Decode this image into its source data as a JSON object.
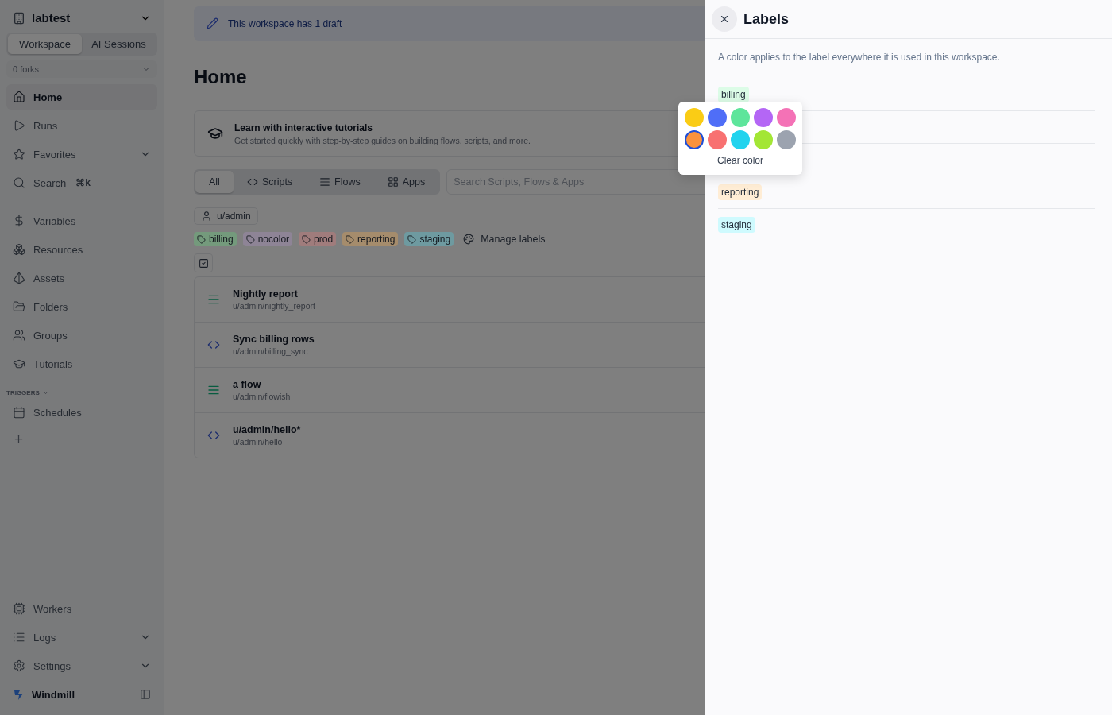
{
  "sidebar": {
    "workspace": "labtest",
    "mode_tabs": [
      {
        "label": "Workspace",
        "selected": true
      },
      {
        "label": "AI Sessions",
        "selected": false
      }
    ],
    "forks": "0 forks",
    "items": [
      {
        "label": "Home",
        "selected": true,
        "chevron": false
      },
      {
        "label": "Runs",
        "selected": false,
        "chevron": false
      },
      {
        "label": "Favorites",
        "selected": false,
        "chevron": true
      },
      {
        "label": "Search",
        "shortcut": "⌘k",
        "selected": false,
        "chevron": false
      },
      {
        "label": "Variables",
        "selected": false,
        "chevron": false
      },
      {
        "label": "Resources",
        "selected": false,
        "chevron": false
      },
      {
        "label": "Assets",
        "selected": false,
        "chevron": false
      },
      {
        "label": "Folders",
        "selected": false,
        "chevron": false
      },
      {
        "label": "Groups",
        "selected": false,
        "chevron": false
      },
      {
        "label": "Tutorials",
        "selected": false,
        "chevron": false
      }
    ],
    "section": "TRIGGERS",
    "trigger_items": [
      {
        "label": "Schedules",
        "selected": false,
        "chevron": false
      }
    ],
    "bottom_items": [
      {
        "label": "Workers",
        "selected": false,
        "chevron": false
      },
      {
        "label": "Logs",
        "selected": false,
        "chevron": true
      },
      {
        "label": "Settings",
        "selected": false,
        "chevron": true
      }
    ],
    "brand": "Windmill"
  },
  "banner": "This workspace has 1 draft",
  "title": "Home",
  "tutorial": {
    "title": "Learn with interactive tutorials",
    "subtitle": "Get started quickly with step-by-step guides on building flows, scripts, and more."
  },
  "filter_tabs": [
    {
      "label": "All",
      "selected": true
    },
    {
      "label": "Scripts",
      "selected": false
    },
    {
      "label": "Flows",
      "selected": false
    },
    {
      "label": "Apps",
      "selected": false
    }
  ],
  "search": {
    "placeholder": "Search Scripts, Flows & Apps"
  },
  "owner_chip": "u/admin",
  "label_chips": [
    {
      "label": "billing",
      "color": "#749a7c"
    },
    {
      "label": "nocolor",
      "color": "#8e8496"
    },
    {
      "label": "prod",
      "color": "#a07c7c"
    },
    {
      "label": "reporting",
      "color": "#a58c6c"
    },
    {
      "label": "staging",
      "color": "#6e9aa0"
    }
  ],
  "manage_labels": "Manage labels",
  "items": [
    {
      "kind": "flow",
      "name": "Nightly report",
      "path": "u/admin/nightly_report"
    },
    {
      "kind": "script",
      "name": "Sync billing rows",
      "path": "u/admin/billing_sync"
    },
    {
      "kind": "flow",
      "name": "a flow",
      "path": "u/admin/flowish"
    },
    {
      "kind": "script",
      "name": "u/admin/hello*",
      "path": "u/admin/hello"
    }
  ],
  "drawer": {
    "title": "Labels",
    "description": "A color applies to the label everywhere it is used in this workspace.",
    "rows": [
      {
        "kind": "label",
        "label": "billing",
        "color": "#dcfce7"
      },
      {
        "kind": "covered"
      },
      {
        "kind": "covered"
      },
      {
        "kind": "label",
        "label": "reporting",
        "color": "#ffedd5"
      },
      {
        "kind": "label",
        "label": "staging",
        "color": "#cffafe"
      }
    ],
    "color_picker": {
      "swatches": [
        {
          "color": "#facc15",
          "selected": false
        },
        {
          "color": "#4f6ef7",
          "selected": false
        },
        {
          "color": "#5ee59b",
          "selected": false
        },
        {
          "color": "#b466f5",
          "selected": false
        },
        {
          "color": "#f472b6",
          "selected": false
        },
        {
          "color": "#fb923c",
          "selected": true
        },
        {
          "color": "#f87171",
          "selected": false
        },
        {
          "color": "#22d3ee",
          "selected": false
        },
        {
          "color": "#a3e635",
          "selected": false
        },
        {
          "color": "#9ca3af",
          "selected": false
        }
      ],
      "clear": "Clear color"
    }
  }
}
